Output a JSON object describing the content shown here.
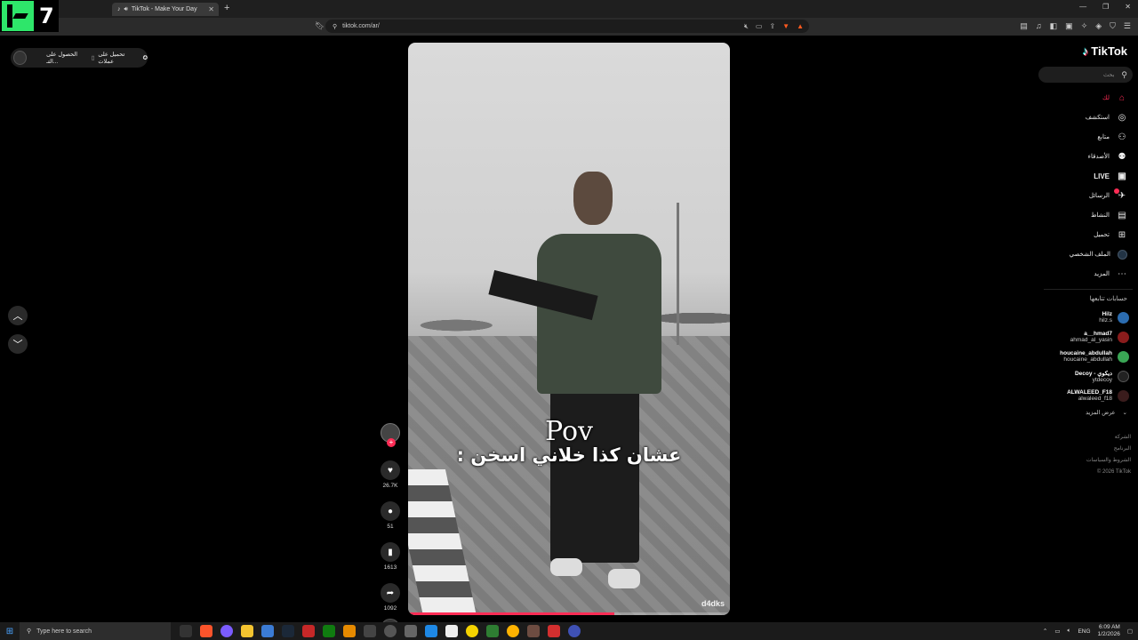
{
  "browser": {
    "tab_title": "TikTok - Make Your Day",
    "tab_close": "✕",
    "new_tab": "+",
    "url": "tiktok.com/ar/",
    "window_controls": [
      "—",
      "❐",
      "✕"
    ]
  },
  "overlay_logo": {
    "text": "7"
  },
  "app_banner": {
    "get_app": "تحميل على عملات",
    "get_coins": "الحصول على التـ..."
  },
  "video": {
    "caption_line1": "Pov",
    "caption_line2": "عشان كذا خلاني اسخن :",
    "watermark": "d4dks",
    "progress": 0.64
  },
  "actions": {
    "like_count": "26.7K",
    "comment_count": "51",
    "save_count": "1613",
    "share_count": "1092",
    "follow_plus": "+"
  },
  "sidebar": {
    "brand": "TikTok",
    "search_placeholder": "بحث",
    "nav": [
      {
        "label": "لك",
        "icon": "home-icon",
        "glyph": "⌂"
      },
      {
        "label": "استكشف",
        "icon": "compass-icon",
        "glyph": "◎"
      },
      {
        "label": "متابع",
        "icon": "following-icon",
        "glyph": "⚇"
      },
      {
        "label": "الأصدقاء",
        "icon": "friends-icon",
        "glyph": "⚉"
      },
      {
        "label": "LIVE",
        "icon": "live-icon",
        "glyph": "▣"
      },
      {
        "label": "الرسائل",
        "icon": "messages-icon",
        "glyph": "✈"
      },
      {
        "label": "النشاط",
        "icon": "activity-icon",
        "glyph": "▤"
      },
      {
        "label": "تحميل",
        "icon": "upload-icon",
        "glyph": "⊞"
      },
      {
        "label": "الملف الشخصي",
        "icon": "profile-icon",
        "glyph": ""
      },
      {
        "label": "المزيد",
        "icon": "more-icon",
        "glyph": "⋯"
      }
    ],
    "following_title": "حسابات تتابعها",
    "accounts": [
      {
        "name": "Hilz",
        "handle": "hilz.s",
        "color": "#2b6cb0"
      },
      {
        "name": "a__hmad7",
        "handle": "ahmad_al_yasin",
        "color": "#8a1c1c"
      },
      {
        "name": "houcaine_abdullah",
        "handle": "houcaine_abdullah",
        "color": "#3aa655"
      },
      {
        "name": "Decoy - ديكوي",
        "handle": "ytdecoy",
        "color": "#222222"
      },
      {
        "name": "ALWALEED_F18",
        "handle": "alwaleed_f18",
        "color": "#3a1c1c"
      }
    ],
    "see_more": "عرض المزيد",
    "footer": [
      "الشركة",
      "البرنامج",
      "الشروط والسياسات",
      "© 2026 TikTok"
    ]
  },
  "taskbar": {
    "search_placeholder": "Type here to search",
    "lang": "ENG",
    "time": "6:09 AM",
    "date": "1/2/2026"
  },
  "colors": {
    "accent": "#fe2c55",
    "brand_cyan": "#25f4ee",
    "background": "#000000"
  }
}
